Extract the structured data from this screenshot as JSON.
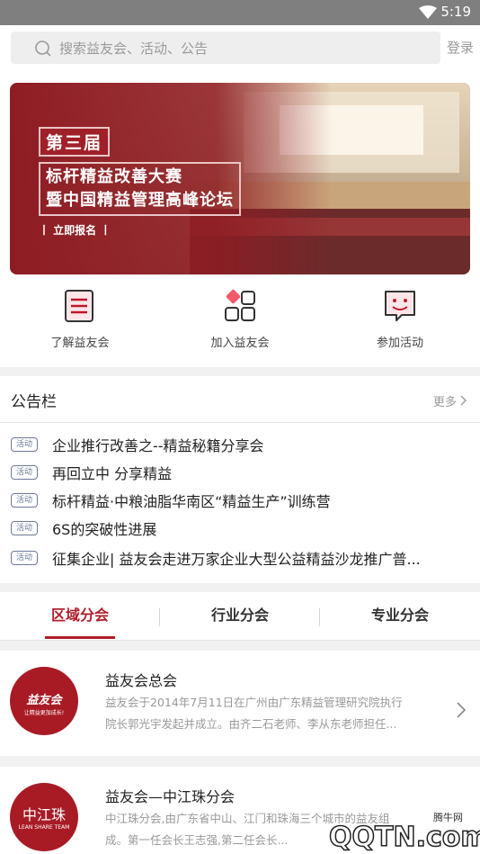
{
  "status": {
    "time": "5:19"
  },
  "search": {
    "placeholder": "搜索益友会、活动、公告",
    "login_label": "登录"
  },
  "banner": {
    "badge": "第三届",
    "title_line1": "标杆精益改善大赛",
    "title_line2": "暨中国精益管理高峰论坛",
    "signup": "丨 立即报名 丨"
  },
  "quick_actions": [
    {
      "label": "了解益友会",
      "icon": "document-icon"
    },
    {
      "label": "加入益友会",
      "icon": "apps-grid-icon"
    },
    {
      "label": "参加活动",
      "icon": "smile-chat-icon"
    }
  ],
  "notice": {
    "heading": "公告栏",
    "more_label": "更多",
    "items": [
      {
        "tag": "活动",
        "text": "企业推行改善之--精益秘籍分享会"
      },
      {
        "tag": "活动",
        "text": "再回立中 分享精益"
      },
      {
        "tag": "活动",
        "text": "标杆精益·中粮油脂华南区“精益生产”训练营"
      },
      {
        "tag": "活动",
        "text": "6S的突破性进展"
      },
      {
        "tag": "活动",
        "text": "征集企业| 益友会走进万家企业大型公益精益沙龙推广普..."
      }
    ]
  },
  "tabs": [
    {
      "label": "区域分会",
      "active": true
    },
    {
      "label": "行业分会",
      "active": false
    },
    {
      "label": "专业分会",
      "active": false
    }
  ],
  "branches": [
    {
      "name": "益友会总会",
      "logo_text": "益友会",
      "logo_subtext": "让精益更加成长!",
      "desc_line1": "益友会于2014年7月11日在广州由广东精益管理研究院执行",
      "desc_line2": "院长郭光宇发起并成立。由齐二石老师、李从东老师担任..."
    },
    {
      "name": "益友会—中江珠分会",
      "logo_text": "中江珠",
      "logo_subtext": "LEAN SHARE TEAM",
      "desc_line1": "中江珠分会,由广东省中山、江门和珠海三个城市的益友组",
      "desc_line2": "成。第一任会长王志强,第二任会长..."
    }
  ],
  "watermark": {
    "text": "QQTN.com",
    "sub": "腾牛网"
  },
  "colors": {
    "accent": "#b01e2a",
    "tag": "#6b7a99",
    "banner": "#8e1c23"
  }
}
